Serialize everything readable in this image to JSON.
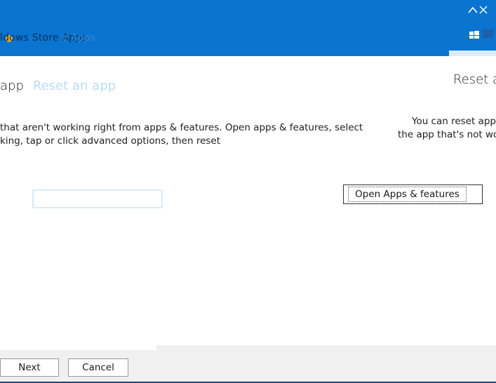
{
  "window": {
    "title": "ldows Store Apps",
    "title_ghost": "e Apps",
    "brand_color": "#0a74d0"
  },
  "content": {
    "heading_left": "app",
    "heading_ghost": "Reset an app",
    "heading_right": "Reset a",
    "body_left_lines": [
      "that aren't working right from apps & features. Open apps & features, select",
      "king, tap or click advanced options, then reset"
    ],
    "body_right_lines": [
      "You can reset app",
      "the app that's not wor"
    ],
    "open_button_label": "Open Apps & features"
  },
  "footer": {
    "next_label": "Next",
    "cancel_label": "Cancel"
  },
  "icons": [
    "chevron-up-icon",
    "close-icon",
    "windows-logo-icon",
    "app-icon"
  ]
}
